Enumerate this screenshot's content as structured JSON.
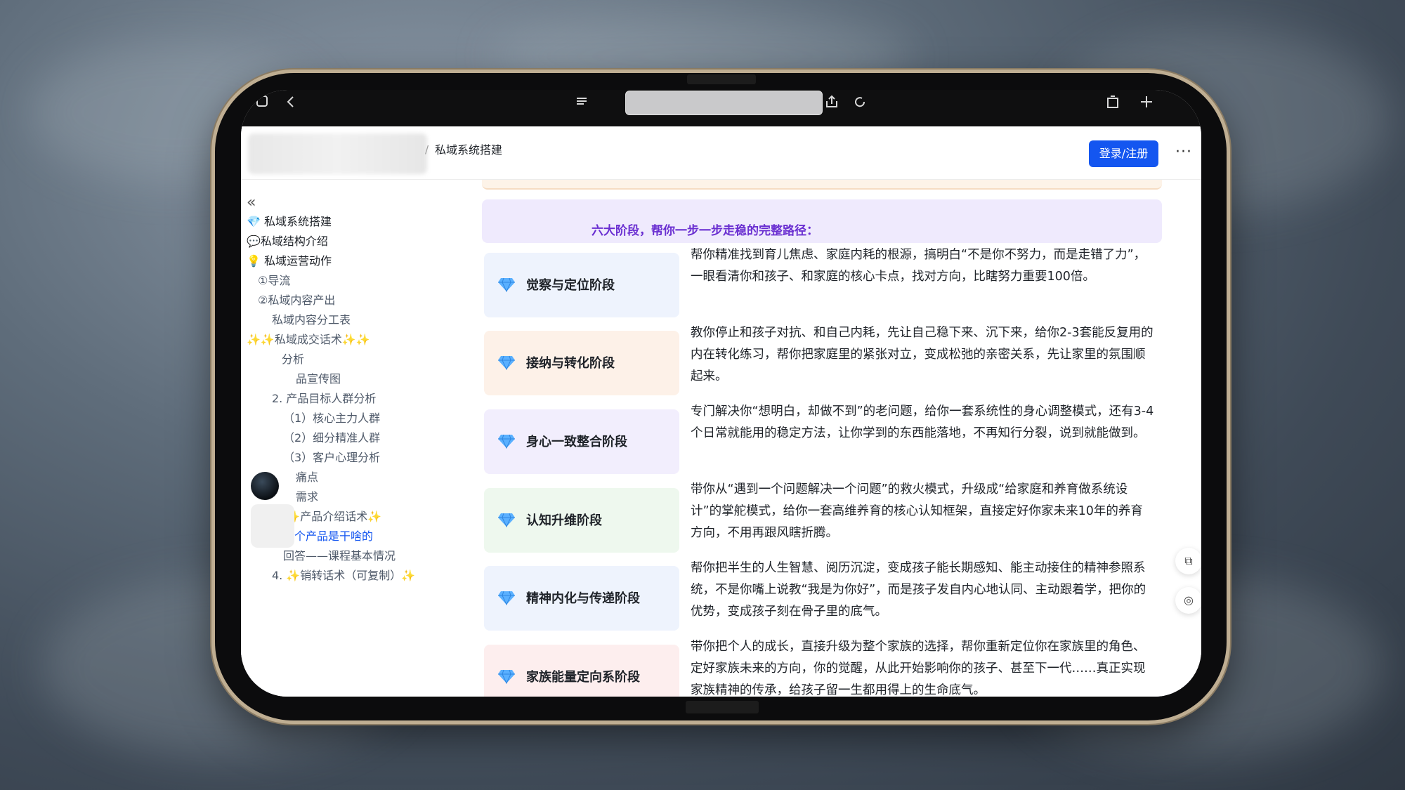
{
  "header": {
    "breadcrumb": "私域系统搭建",
    "login_label": "登录/注册",
    "more_label": "···"
  },
  "sidebar": {
    "collapse_label": "«",
    "items": [
      {
        "label": "💎 私域系统搭建"
      },
      {
        "label": "💬私域结构介绍"
      },
      {
        "label": "💡 私域运营动作"
      },
      {
        "label": "①导流"
      },
      {
        "label": "②私域内容产出"
      },
      {
        "label": "私域内容分工表"
      },
      {
        "label": "✨✨私域成交话术✨✨"
      },
      {
        "label": "分析"
      },
      {
        "label": "品宣传图"
      },
      {
        "label": "2. 产品目标人群分析"
      },
      {
        "label": "（1）核心主力人群"
      },
      {
        "label": "（2）细分精准人群"
      },
      {
        "label": "（3）客户心理分析"
      },
      {
        "label": "痛点"
      },
      {
        "label": "需求"
      },
      {
        "label": "3. ✨产品介绍话术✨"
      },
      {
        "label": "这个产品是干啥的"
      },
      {
        "label": "回答——课程基本情况"
      },
      {
        "label": "4. ✨销转话术（可复制）✨"
      }
    ]
  },
  "content": {
    "intro": "六大阶段，帮你一步一步走稳的完整路径：",
    "stages": [
      {
        "title": "觉察与定位阶段",
        "color": "#eef3fd",
        "desc": "帮你精准找到育儿焦虑、家庭内耗的根源，搞明白“不是你不努力，而是走错了力”，一眼看清你和孩子、和家庭的核心卡点，找对方向，比瞎努力重要100倍。"
      },
      {
        "title": "接纳与转化阶段",
        "color": "#fdf1e8",
        "desc": "教你停止和孩子对抗、和自己内耗，先让自己稳下来、沉下来，给你2-3套能反复用的内在转化练习，帮你把家庭里的紧张对立，变成松弛的亲密关系，先让家里的氛围顺起来。"
      },
      {
        "title": "身心一致整合阶段",
        "color": "#f2eefd",
        "desc": "专门解决你“想明白，却做不到”的老问题，给你一套系统性的身心调整模式，还有3-4个日常就能用的稳定方法，让你学到的东西能落地，不再知行分裂，说到就能做到。"
      },
      {
        "title": "认知升维阶段",
        "color": "#eef8ee",
        "desc": "带你从“遇到一个问题解决一个问题”的救火模式，升级成“给家庭和养育做系统设计”的掌舵模式，给你一套高维养育的核心认知框架，直接定好你家未来10年的养育方向，不用再跟风瞎折腾。"
      },
      {
        "title": "精神内化与传递阶段",
        "color": "#eef3fd",
        "desc": "帮你把半生的人生智慧、阅历沉淀，变成孩子能长期感知、能主动接住的精神参照系统，不是你嘴上说教“我是为你好”，而是孩子发自内心地认同、主动跟着学，把你的优势，变成孩子刻在骨子里的底气。"
      },
      {
        "title": "家族能量定向系阶段",
        "color": "#fdeeee",
        "desc": "带你把个人的成长，直接升级为整个家族的选择，帮你重新定位你在家族里的角色、定好家族未来的方向，你的觉醒，从此开始影响你的孩子、甚至下一代……真正实现家族精神的传承，给孩子留一生都用得上的生命底气。"
      }
    ]
  },
  "icons": {
    "stage_icon": "diamond-icon",
    "float_1": "copy-icon",
    "float_2": "comment-icon"
  },
  "colors": {
    "accent": "#1456f0",
    "intro_text": "#6a2fd1",
    "active_link": "#1456f0"
  }
}
